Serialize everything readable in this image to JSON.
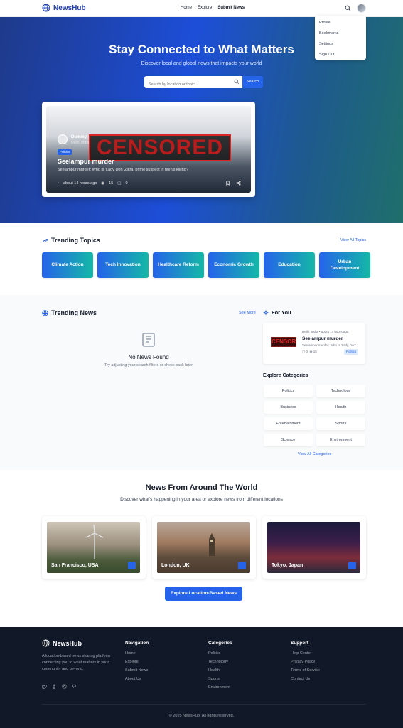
{
  "header": {
    "logo_text": "NewsHub",
    "nav": [
      "Home",
      "Explore",
      "Submit News"
    ],
    "dropdown": [
      "Profile",
      "Bookmarks",
      "Settings",
      "Sign Out"
    ]
  },
  "hero": {
    "title": "Stay Connected to What Matters",
    "subtitle": "Discover local and global news that impacts your world",
    "search_placeholder": "Search by location or topic...",
    "search_button": "Search"
  },
  "featured": {
    "author": "Dummy",
    "location": "Delhi, India",
    "tag": "Politics",
    "censored_label": "CENSORED",
    "title": "Seelampur murder",
    "description": "Seelampur murder: Who is 'Lady Don' Zikra, prime suspect in teen's killing?",
    "time": "about 14 hours ago",
    "views": "15",
    "comments": "0"
  },
  "trending_topics": {
    "title": "Trending Topics",
    "view_all": "View All Topics",
    "items": [
      "Climate Action",
      "Tech Innovation",
      "Healthcare Reform",
      "Economic Growth",
      "Education",
      "Urban Development"
    ]
  },
  "trending_news": {
    "title": "Trending News",
    "see_more": "See More",
    "empty_title": "No News Found",
    "empty_sub": "Try adjusting your search filters or check back later"
  },
  "for_you": {
    "title": "For You",
    "card": {
      "location": "Delhi, India",
      "time": "about 14 hours ago",
      "title": "Seelampur murder",
      "description": "Seelampur murder: Who is 'Lady Don'...",
      "comments": "0",
      "views": "15",
      "tag": "Politics"
    }
  },
  "categories": {
    "title": "Explore Categories",
    "items": [
      "Politics",
      "Technology",
      "Business",
      "Health",
      "Entertainment",
      "Sports",
      "Science",
      "Environment"
    ],
    "view_all": "View All Categories"
  },
  "world": {
    "title": "News From Around The World",
    "subtitle": "Discover what's happening in your area or explore news from different locations",
    "locations": [
      "San Francisco, USA",
      "London, UK",
      "Tokyo, Japan"
    ],
    "explore_button": "Explore Location-Based News"
  },
  "footer": {
    "logo_text": "NewsHub",
    "description": "A location-based news sharing platform connecting you to what matters in your community and beyond.",
    "navigation": {
      "title": "Navigation",
      "items": [
        "Home",
        "Explore",
        "Submit News",
        "About Us"
      ]
    },
    "categories": {
      "title": "Categories",
      "items": [
        "Politics",
        "Technology",
        "Health",
        "Sports",
        "Environment"
      ]
    },
    "support": {
      "title": "Support",
      "items": [
        "Help Center",
        "Privacy Policy",
        "Terms of Service",
        "Contact Us"
      ]
    },
    "copyright": "© 2025 NewsHub. All rights reserved."
  },
  "colors": {
    "primary": "#2563eb",
    "brand": "#1e40af",
    "teal": "#14b8a6",
    "footer_bg": "#111827"
  }
}
